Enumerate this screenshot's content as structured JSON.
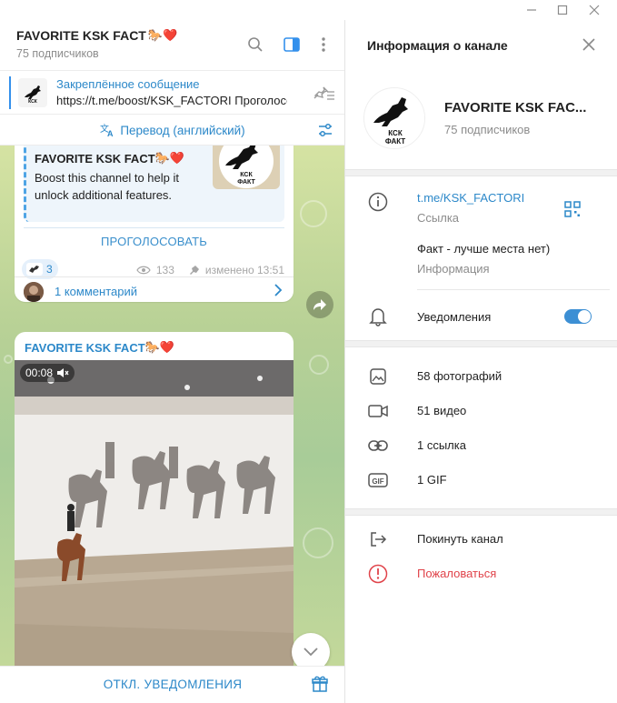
{
  "chat": {
    "title": "FAVORITE KSK FACT",
    "title_emoji": "🐎❤️",
    "subscribers": "75 подписчиков",
    "pinned": {
      "label": "Закреплённое сообщение",
      "text": "https://t.me/boost/KSK_FACTORI  Проголосовать"
    },
    "translate": "Перевод (английский)",
    "post1": {
      "quote_title": "FAVORITE KSK FACT",
      "quote_body": "Boost this channel to help it unlock additional features.",
      "vote": "ПРОГОЛОСОВАТЬ",
      "reaction_count": "3",
      "views": "133",
      "edited": "изменено 13:51",
      "comments": "1 комментарий"
    },
    "post2": {
      "title": "FAVORITE KSK FACT",
      "video_time": "00:08"
    },
    "logo_text_line1": "КСК",
    "logo_text_line2": "ФАКТ",
    "bottom_action": "ОТКЛ. УВЕДОМЛЕНИЯ"
  },
  "info": {
    "header": "Информация о канале",
    "name": "FAVORITE KSK FAC...",
    "subscribers": "75 подписчиков",
    "link": "t.me/KSK_FACTORI",
    "link_label": "Ссылка",
    "description": "Факт  - лучше места нет)",
    "description_label": "Информация",
    "notifications": "Уведомления",
    "notifications_on": true,
    "photos": "58 фотографий",
    "videos": "51 видео",
    "links": "1 ссылка",
    "gifs": "1 GIF",
    "gif_icon_text": "GIF",
    "leave": "Покинуть канал",
    "report": "Пожаловаться"
  },
  "colors": {
    "accent": "#2c88c9",
    "toggle": "#3c8fd4",
    "danger": "#e0434a"
  }
}
